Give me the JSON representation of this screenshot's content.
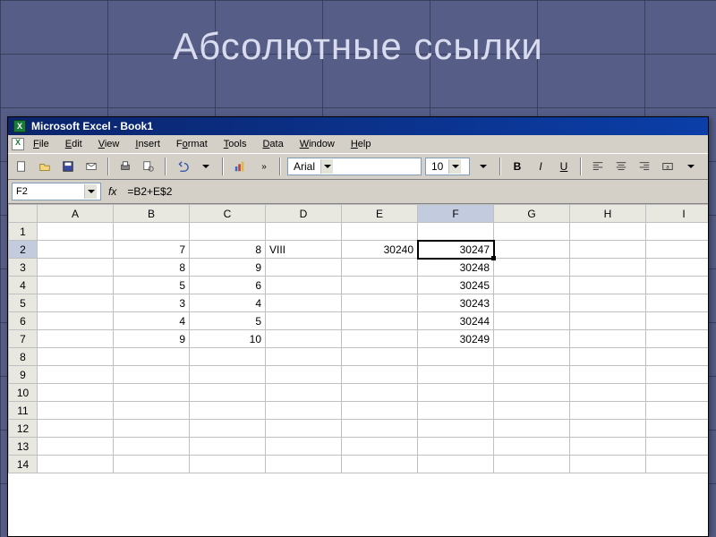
{
  "slide": {
    "title": "Абсолютные ссылки"
  },
  "titlebar": {
    "app_name": "Microsoft Excel - Book1",
    "app_icon_letter": "X"
  },
  "menu": [
    "File",
    "Edit",
    "View",
    "Insert",
    "Format",
    "Tools",
    "Data",
    "Window",
    "Help"
  ],
  "toolbar": {
    "font_name": "Arial",
    "font_size": "10",
    "bold_label": "B",
    "italic_label": "I",
    "underline_label": "U",
    "expand_label": "»"
  },
  "formula_bar": {
    "name_box": "F2",
    "fx_label": "fx",
    "formula": "=B2+E$2"
  },
  "grid": {
    "columns": [
      "A",
      "B",
      "C",
      "D",
      "E",
      "F",
      "G",
      "H",
      "I"
    ],
    "row_count": 14,
    "selected_cell": "F2",
    "rows": [
      {
        "r": 1,
        "cells": {}
      },
      {
        "r": 2,
        "cells": {
          "B": "7",
          "C": "8",
          "D": "VIII",
          "E": "30240",
          "F": "30247"
        }
      },
      {
        "r": 3,
        "cells": {
          "B": "8",
          "C": "9",
          "F": "30248"
        }
      },
      {
        "r": 4,
        "cells": {
          "B": "5",
          "C": "6",
          "F": "30245"
        }
      },
      {
        "r": 5,
        "cells": {
          "B": "3",
          "C": "4",
          "F": "30243"
        }
      },
      {
        "r": 6,
        "cells": {
          "B": "4",
          "C": "5",
          "F": "30244"
        }
      },
      {
        "r": 7,
        "cells": {
          "B": "9",
          "C": "10",
          "F": "30249"
        }
      },
      {
        "r": 8,
        "cells": {}
      },
      {
        "r": 9,
        "cells": {}
      },
      {
        "r": 10,
        "cells": {}
      },
      {
        "r": 11,
        "cells": {}
      },
      {
        "r": 12,
        "cells": {}
      },
      {
        "r": 13,
        "cells": {}
      },
      {
        "r": 14,
        "cells": {}
      }
    ]
  }
}
